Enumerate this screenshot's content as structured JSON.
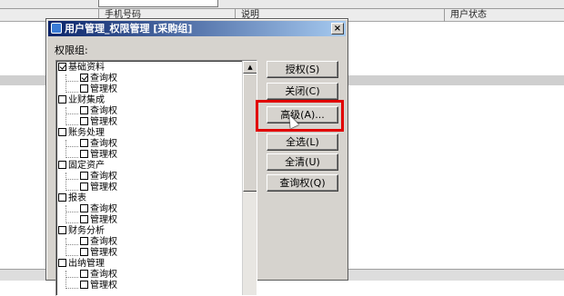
{
  "background": {
    "columns": [
      "手机号码",
      "说明",
      "用户状态"
    ]
  },
  "dialog": {
    "title": "用户管理_权限管理 [采购组]",
    "close_label": "×",
    "group_label": "权限组:",
    "buttons": {
      "grant": "授权(S)",
      "close": "关闭(C)",
      "advanced": "高级(A)...",
      "select_all": "全选(L)",
      "clear_all": "全清(U)",
      "query": "查询权(Q)"
    },
    "tree": [
      {
        "label": "基础资料",
        "checked": true,
        "children": [
          {
            "label": "查询权",
            "checked": true
          },
          {
            "label": "管理权",
            "checked": false
          }
        ]
      },
      {
        "label": "业财集成",
        "checked": false,
        "children": [
          {
            "label": "查询权",
            "checked": false
          },
          {
            "label": "管理权",
            "checked": false
          }
        ]
      },
      {
        "label": "账务处理",
        "checked": false,
        "children": [
          {
            "label": "查询权",
            "checked": false
          },
          {
            "label": "管理权",
            "checked": false
          }
        ]
      },
      {
        "label": "固定资产",
        "checked": false,
        "children": [
          {
            "label": "查询权",
            "checked": false
          },
          {
            "label": "管理权",
            "checked": false
          }
        ]
      },
      {
        "label": "报表",
        "checked": false,
        "children": [
          {
            "label": "查询权",
            "checked": false
          },
          {
            "label": "管理权",
            "checked": false
          }
        ]
      },
      {
        "label": "财务分析",
        "checked": false,
        "children": [
          {
            "label": "查询权",
            "checked": false
          },
          {
            "label": "管理权",
            "checked": false
          }
        ]
      },
      {
        "label": "出纳管理",
        "checked": false,
        "children": [
          {
            "label": "查询权",
            "checked": false
          },
          {
            "label": "管理权",
            "checked": false
          }
        ]
      }
    ]
  }
}
